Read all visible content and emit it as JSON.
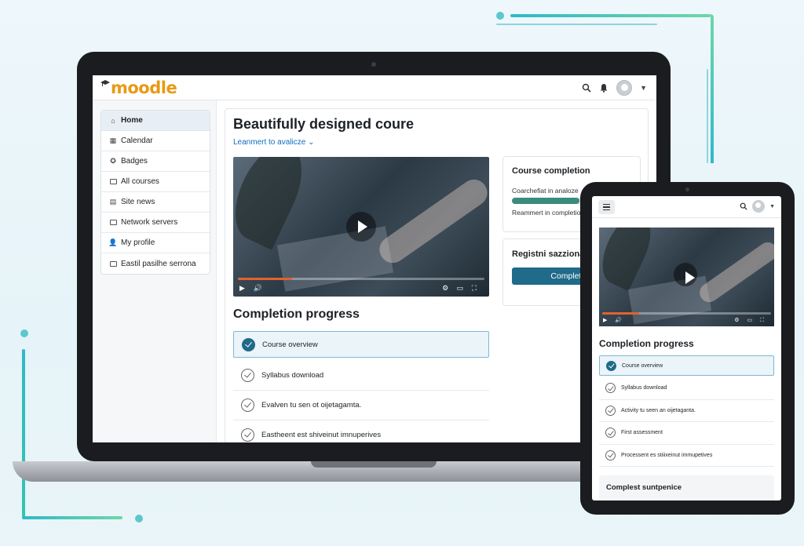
{
  "brand": {
    "logo_text": "moodle",
    "accent": "#e89a14",
    "primary": "#206a8a"
  },
  "sidebar": {
    "items": [
      {
        "label": "Home",
        "icon": "home-icon",
        "active": true
      },
      {
        "label": "Calendar",
        "icon": "calendar-icon"
      },
      {
        "label": "Badges",
        "icon": "badge-icon"
      },
      {
        "label": "All courses",
        "icon": "folder-icon"
      },
      {
        "label": "Site news",
        "icon": "news-icon"
      },
      {
        "label": "Network servers",
        "icon": "folder-icon"
      },
      {
        "label": "My profile",
        "icon": "user-icon"
      },
      {
        "label": "Eastil pasilhe serrona",
        "icon": "folder-icon"
      }
    ]
  },
  "course": {
    "title": "Beautifully designed coure",
    "subtitle": "Leanmert to avalicze"
  },
  "video": {
    "progress": 0.22
  },
  "completion_panel": {
    "title": "Course completion",
    "line1": "Coarchefiat in analoze",
    "progress": 0.72,
    "line2": "Reammert in completion"
  },
  "register_panel": {
    "title": "Registni sazziona mentbara!",
    "button": "Complete r"
  },
  "progress_section": {
    "title": "Completion progress",
    "items": [
      {
        "label": "Course overview",
        "active": true
      },
      {
        "label": "Syllabus download"
      },
      {
        "label": "Evalven tu sen ot oijetagamta."
      },
      {
        "label": "Eastheent est shiveinut imnuperives"
      }
    ]
  },
  "tablet": {
    "progress_title": "Completion progress",
    "items": [
      {
        "label": "Course overview",
        "active": true
      },
      {
        "label": "Syllabus download"
      },
      {
        "label": "Activity tu seen an oijetaganta."
      },
      {
        "label": "First assessment"
      },
      {
        "label": "Processent es stiiixeinut immupetives"
      }
    ],
    "footer": "Complest suntpenice"
  }
}
